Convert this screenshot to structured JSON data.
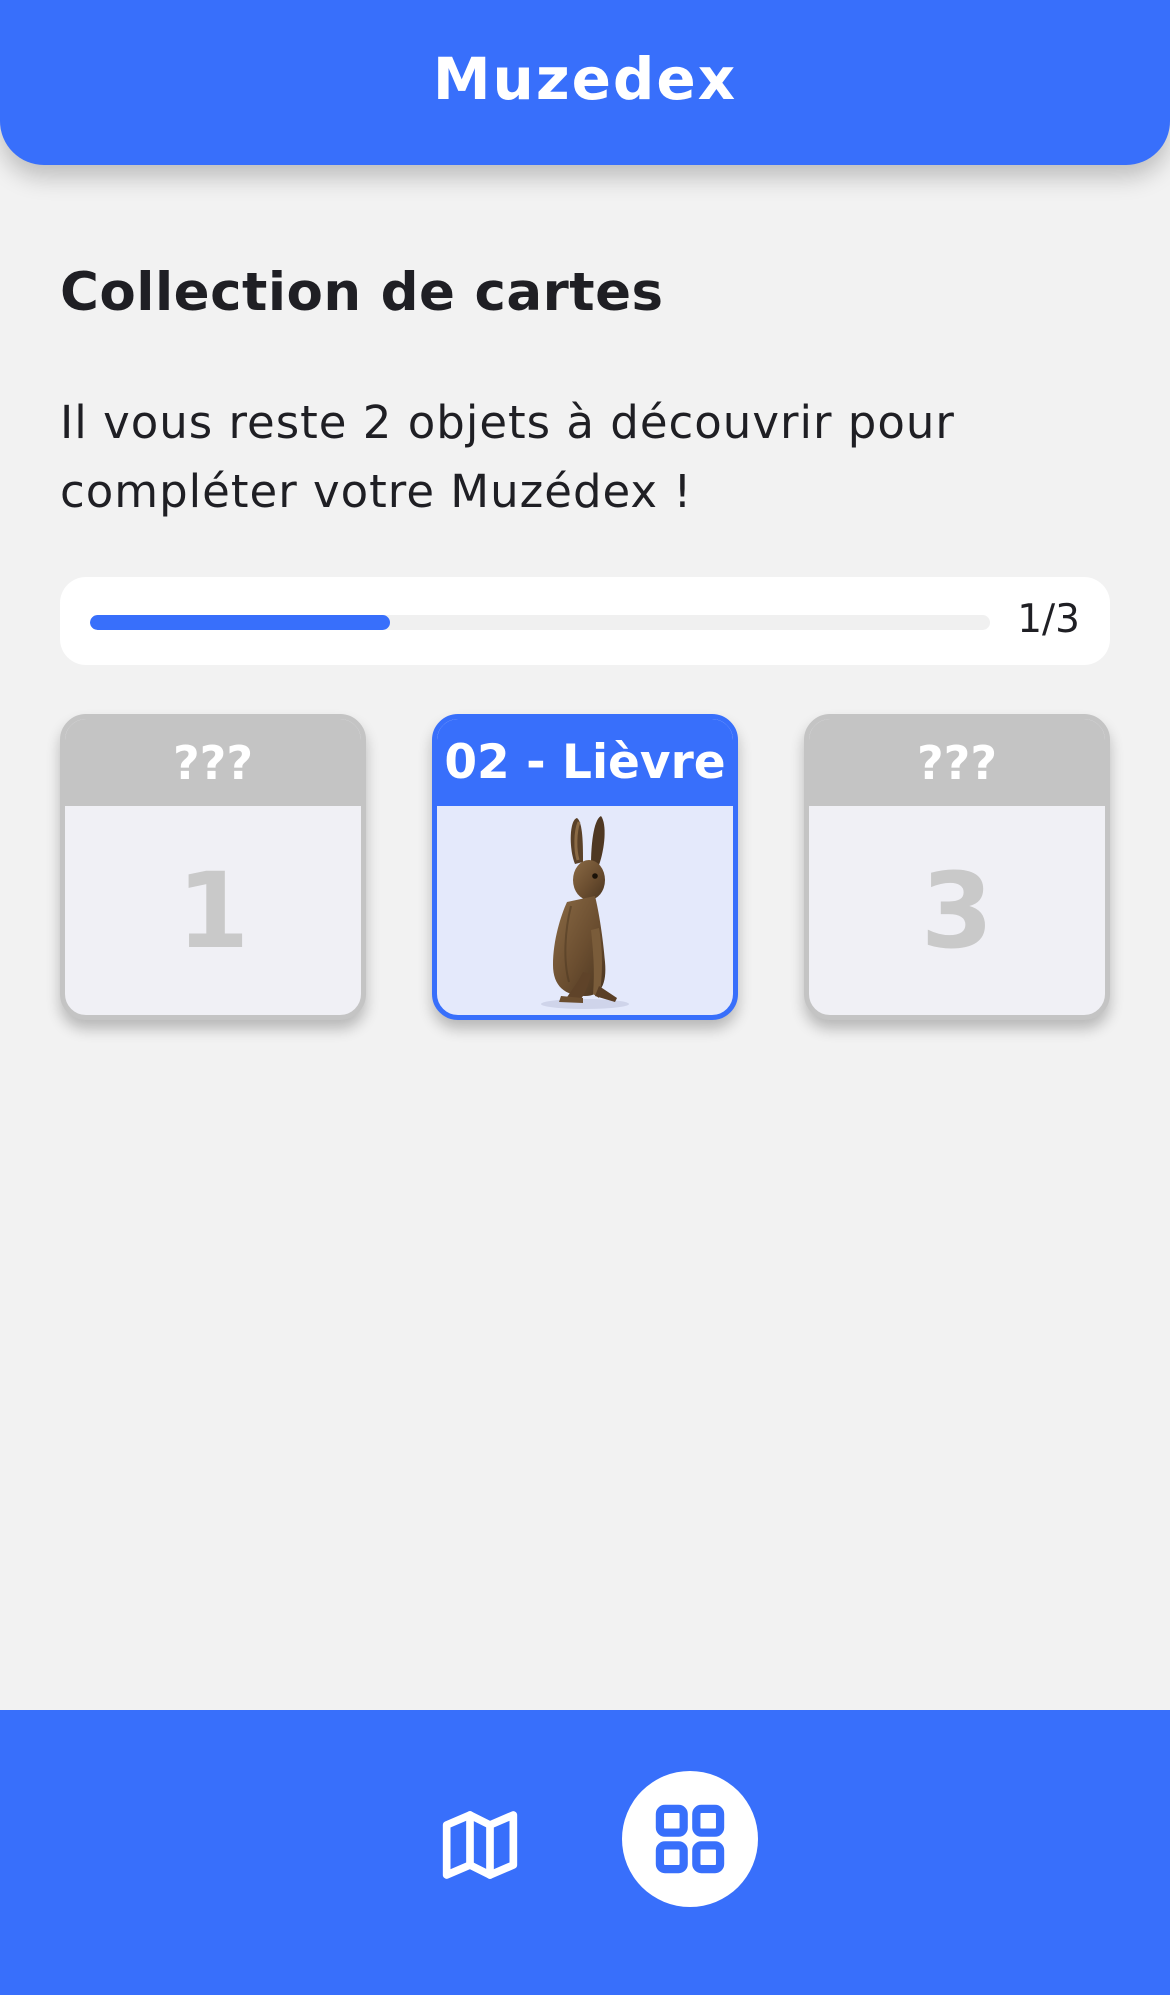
{
  "header": {
    "title": "Muzedex"
  },
  "collection": {
    "title": "Collection de cartes",
    "subtitle": "Il vous reste 2 objets à découvrir pour compléter votre Muzédex !",
    "progress": {
      "fraction": 0.333,
      "label": "1/3"
    },
    "cards": [
      {
        "title": "???",
        "number": "1",
        "discovered": false
      },
      {
        "title": "02 - Lièvre",
        "image": "hare",
        "discovered": true
      },
      {
        "title": "???",
        "number": "3",
        "discovered": false
      }
    ]
  },
  "nav": {
    "items": [
      {
        "icon": "map-icon",
        "active": false
      },
      {
        "icon": "grid-icon",
        "active": true
      }
    ]
  },
  "colors": {
    "primary": "#386ffb",
    "background": "#f2f2f2",
    "locked_card": "#c4c4c4",
    "discovered_card_bg": "#e4e9fb"
  }
}
